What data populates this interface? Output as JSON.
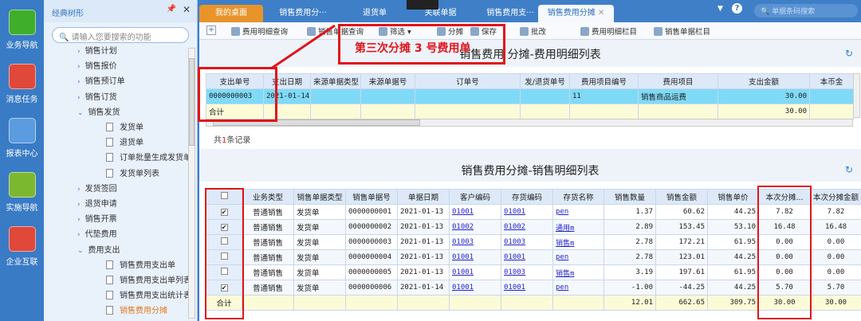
{
  "nav": [
    "业务导航",
    "消息任务",
    "报表中心",
    "实施导航",
    "企业互联"
  ],
  "tree": {
    "title": "经典树形",
    "search_placeholder": "请输入您要搜索的功能",
    "items": [
      {
        "label": "销售计划",
        "type": "folder"
      },
      {
        "label": "销售报价",
        "type": "folder"
      },
      {
        "label": "销售预订单",
        "type": "folder"
      },
      {
        "label": "销售订货",
        "type": "folder"
      },
      {
        "label": "销售发货",
        "type": "open"
      },
      {
        "label": "发货单",
        "type": "doc"
      },
      {
        "label": "退货单",
        "type": "doc"
      },
      {
        "label": "订单批量生成发货单",
        "type": "doc"
      },
      {
        "label": "发货单列表",
        "type": "doc"
      },
      {
        "label": "发货签回",
        "type": "folder"
      },
      {
        "label": "退货申请",
        "type": "folder"
      },
      {
        "label": "销售开票",
        "type": "folder"
      },
      {
        "label": "代垫费用",
        "type": "folder"
      },
      {
        "label": "费用支出",
        "type": "open"
      },
      {
        "label": "销售费用支出单",
        "type": "doc"
      },
      {
        "label": "销售费用支出单列表",
        "type": "doc"
      },
      {
        "label": "销售费用支出统计表",
        "type": "doc"
      },
      {
        "label": "销售费用分摊",
        "type": "doc",
        "active": true
      }
    ]
  },
  "tabs": [
    "我的桌面",
    "销售费用分···",
    "退货单",
    "关联单据",
    "销售费用支···",
    "销售费用分摊"
  ],
  "top_search_placeholder": "单据条码搜索",
  "toolbar": [
    "费用明细查询",
    "销售单据查询",
    "筛选",
    "分摊",
    "保存",
    "批改",
    "费用明细栏目",
    "销售单据栏目"
  ],
  "annotation": "第三次分摊 3 号费用单",
  "table1": {
    "title": "销售费用 分摊-费用明细列表",
    "headers": [
      "支出单号",
      "支出日期",
      "来源单据类型",
      "来源单据号",
      "订单号",
      "发/退货单号",
      "费用项目编号",
      "费用项目",
      "支出金额",
      "本币金"
    ],
    "rows": [
      [
        "0000000003",
        "2021-01-14",
        "",
        "",
        "",
        "",
        "11",
        "销售商品运费",
        "30.00",
        ""
      ]
    ],
    "total": [
      "合计",
      "",
      "",
      "",
      "",
      "",
      "",
      "",
      "30.00",
      ""
    ],
    "records_prefix": "共",
    "records_count": "1",
    "records_suffix": "条记录"
  },
  "table2": {
    "title": "销售费用分摊-销售明细列表",
    "headers": [
      "",
      "业务类型",
      "销售单据类型",
      "销售单据号",
      "单据日期",
      "客户编码",
      "存货编码",
      "存货名称",
      "销售数量",
      "销售金额",
      "销售单价",
      "本次分摊...",
      "本次分摊金额"
    ],
    "rows": [
      {
        "checked": true,
        "cells": [
          "普通销售",
          "发货单",
          "0000000001",
          "2021-01-13",
          "01001",
          "01001",
          "pen",
          "1.37",
          "60.62",
          "44.25",
          "7.82",
          "7.82"
        ]
      },
      {
        "checked": true,
        "cells": [
          "普通销售",
          "发货单",
          "0000000002",
          "2021-01-13",
          "01002",
          "01002",
          "通用m",
          "2.89",
          "153.45",
          "53.10",
          "16.48",
          "16.48"
        ]
      },
      {
        "checked": false,
        "cells": [
          "普通销售",
          "发货单",
          "0000000003",
          "2021-01-13",
          "01003",
          "01003",
          "销售m",
          "2.78",
          "172.21",
          "61.95",
          "0.00",
          "0.00"
        ]
      },
      {
        "checked": false,
        "cells": [
          "普通销售",
          "发货单",
          "0000000004",
          "2021-01-13",
          "01001",
          "01001",
          "pen",
          "2.78",
          "123.01",
          "44.25",
          "0.00",
          "0.00"
        ]
      },
      {
        "checked": false,
        "cells": [
          "普通销售",
          "发货单",
          "0000000005",
          "2021-01-13",
          "01001",
          "01003",
          "销售m",
          "3.19",
          "197.61",
          "61.95",
          "0.00",
          "0.00"
        ]
      },
      {
        "checked": true,
        "cells": [
          "普通销售",
          "发货单",
          "0000000006",
          "2021-01-14",
          "01001",
          "01001",
          "pen",
          "-1.00",
          "-44.25",
          "44.25",
          "5.70",
          "5.70"
        ]
      }
    ],
    "total": [
      "合计",
      "",
      "",
      "",
      "",
      "",
      "",
      "",
      "12.01",
      "662.65",
      "309.75",
      "30.00",
      "30.00"
    ]
  }
}
